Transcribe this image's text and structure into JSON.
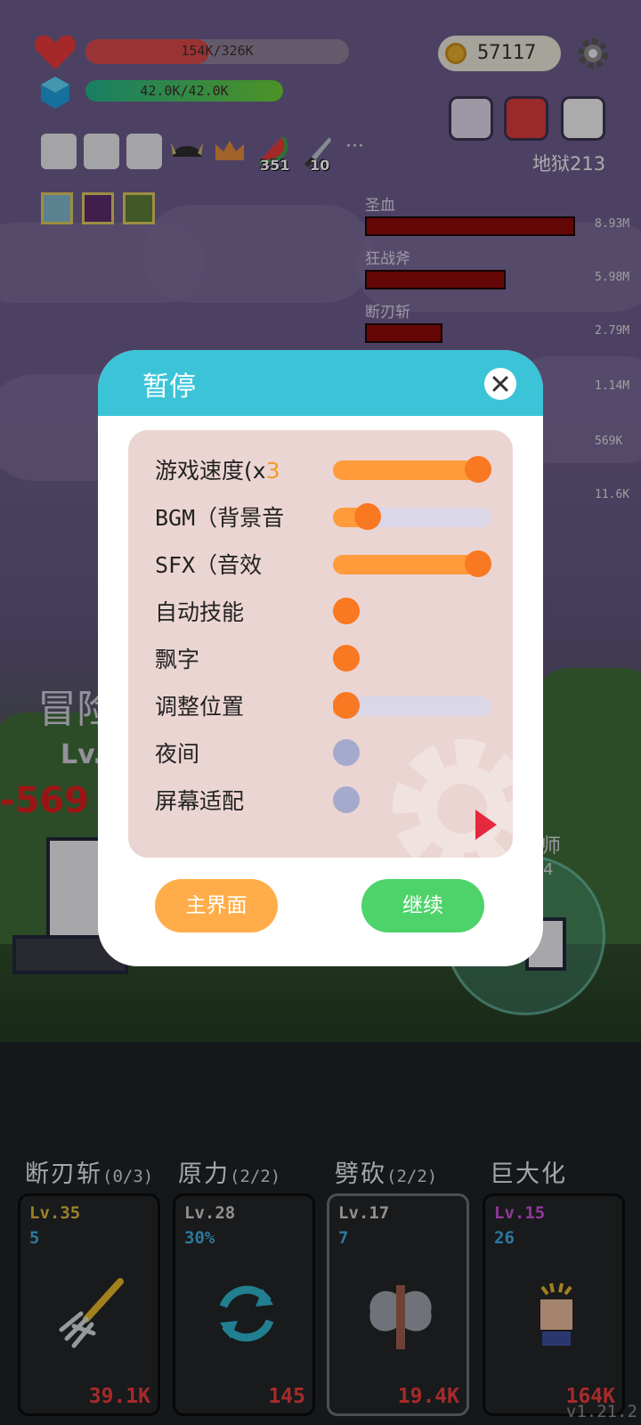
{
  "hud": {
    "hp_text": "154K/326K",
    "hp_fraction": 0.47,
    "mp_text": "42.0K/42.0K",
    "mp_fraction": 1.0,
    "coins": "57117",
    "item_counts": [
      "351",
      "10"
    ],
    "more": "···",
    "stage": "地狱213"
  },
  "damage_board": [
    {
      "name": "圣血",
      "value": "8.93M",
      "fraction": 1.0
    },
    {
      "name": "狂战斧",
      "value": "5.98M",
      "fraction": 0.67
    },
    {
      "name": "断刃斩",
      "value": "2.79M",
      "fraction": 0.37
    },
    {
      "value": "1.14M"
    },
    {
      "value": "569K"
    },
    {
      "value": "11.6K"
    }
  ],
  "battle": {
    "hero_name_partial": "冒险",
    "hero_level_partial": "Lv.",
    "damage_popup": "-569",
    "enemy_name_partial": "师",
    "enemy_level_partial": "4"
  },
  "pause_dialog": {
    "title": "暂停",
    "settings": [
      {
        "label_main": "游戏速度(x",
        "label_highlight": "3",
        "type": "slider",
        "value": 1.0
      },
      {
        "label_main": "BGM（背景音",
        "type": "slider",
        "value": 0.22
      },
      {
        "label_main": "SFX（音效",
        "type": "slider",
        "value": 1.0
      },
      {
        "label_main": "自动技能",
        "type": "toggle",
        "on": true
      },
      {
        "label_main": "飘字",
        "type": "toggle",
        "on": true
      },
      {
        "label_main": "调整位置",
        "type": "slider",
        "value": 0.0
      },
      {
        "label_main": "夜间",
        "type": "toggle",
        "on": false
      },
      {
        "label_main": "屏幕适配",
        "type": "toggle",
        "on": false
      }
    ],
    "home_button": "主界面",
    "continue_button": "继续"
  },
  "skills": [
    {
      "name": "断刃斩",
      "charges": "(0/3)",
      "level": "Lv.35",
      "stat": "5",
      "cost": "39.1K",
      "level_color": "#d9b23a",
      "icon": "trident-icon"
    },
    {
      "name": "原力",
      "charges": "(2/2)",
      "level": "Lv.28",
      "stat": "30%",
      "cost": "145",
      "level_color": "#c9c9c9",
      "icon": "cycle-arrows-icon"
    },
    {
      "name": "劈砍",
      "charges": "(2/2)",
      "level": "Lv.17",
      "stat": "7",
      "cost": "19.4K",
      "level_color": "#c9c9c9",
      "icon": "battle-axe-icon"
    },
    {
      "name": "巨大化",
      "charges": "",
      "level": "Lv.15",
      "stat": "26",
      "cost": "164K",
      "level_color": "#c84fd6",
      "icon": "fist-icon"
    }
  ],
  "version": "v1.21.2",
  "colors": {
    "accent": "#3bc4d8",
    "orange": "#f97822",
    "continue": "#4dd36a",
    "home": "#ffad4a"
  }
}
